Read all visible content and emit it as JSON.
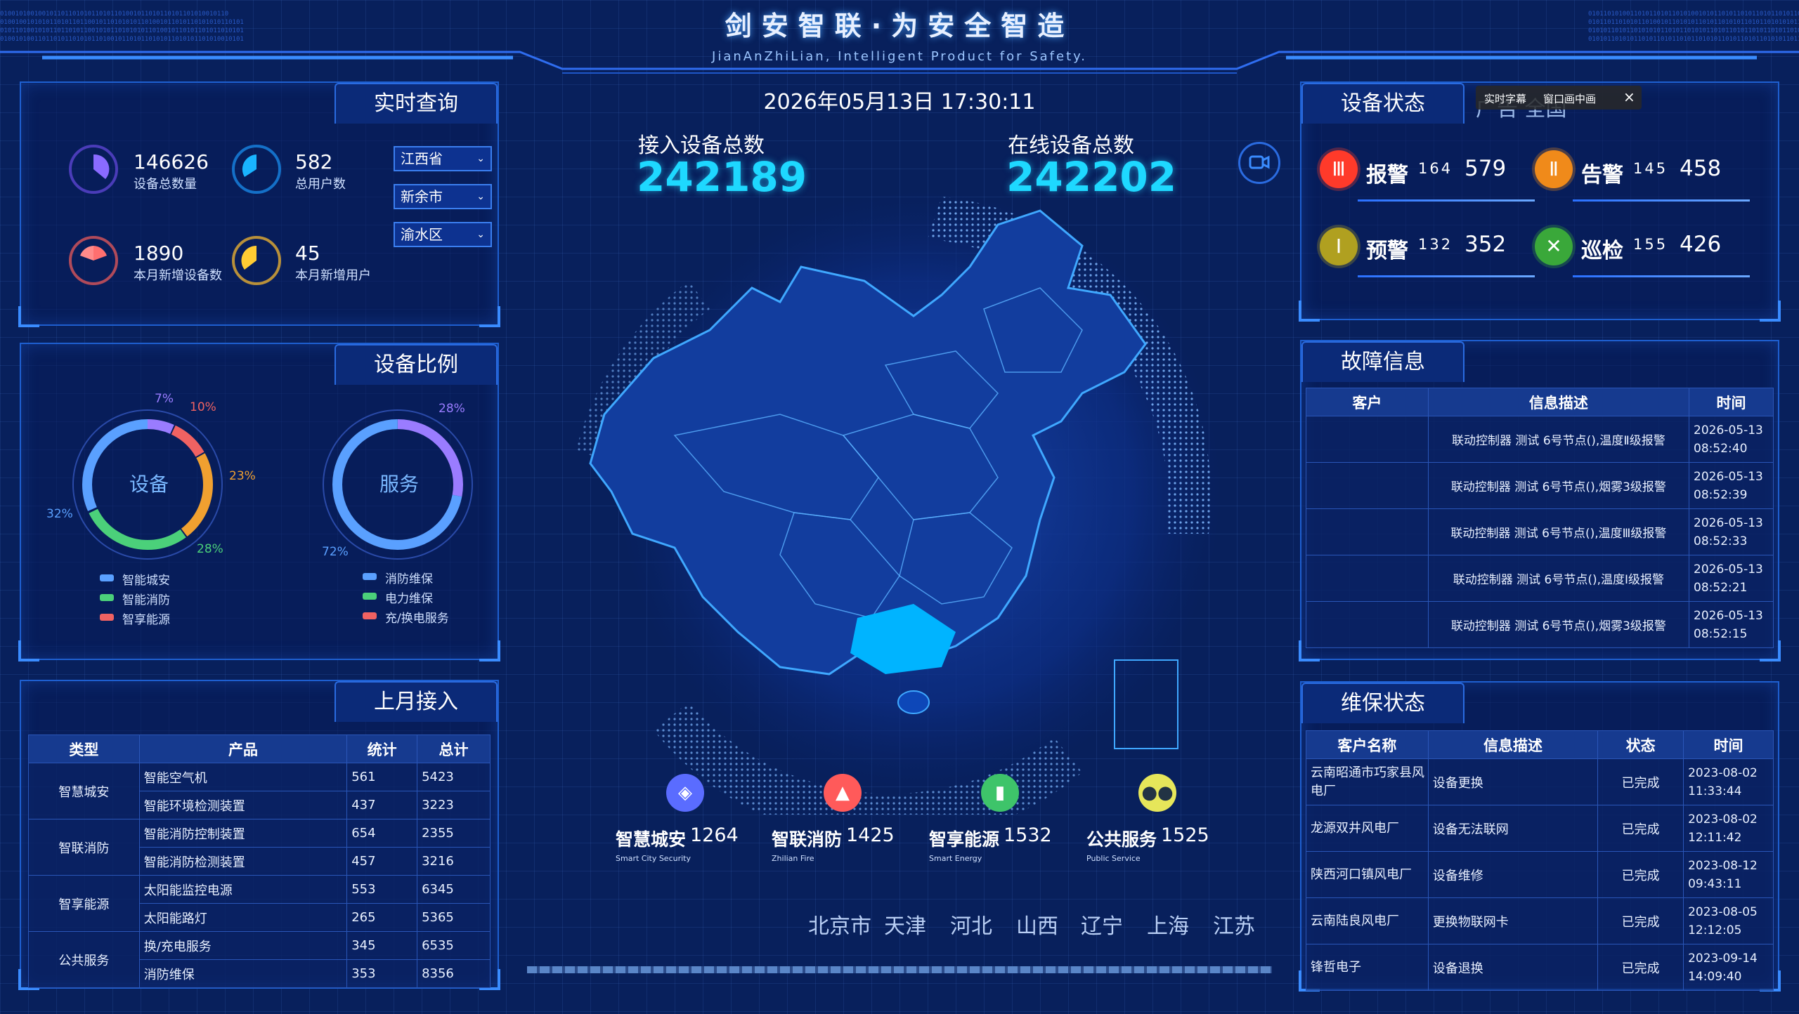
{
  "header": {
    "title": "剑安智联·为安全智造",
    "subtitle": "JianAnZhiLian, Intelligent Product for Safety.",
    "datetime": "2026年05月13日 17:30:11"
  },
  "realtime": {
    "tab": "实时查询",
    "stats": [
      {
        "value": "146626",
        "label": "设备总数量",
        "color": "#7b5cff"
      },
      {
        "value": "582",
        "label": "总用户数",
        "color": "#1ab0ff"
      },
      {
        "value": "1890",
        "label": "本月新增设备数",
        "color": "#ff6a6a"
      },
      {
        "value": "45",
        "label": "本月新增用户",
        "color": "#ffcc33"
      }
    ],
    "selects": [
      "江西省",
      "新余市",
      "渝水区"
    ]
  },
  "ratio": {
    "tab": "设备比例",
    "device": {
      "center": "设备",
      "pct_labels": [
        "7%",
        "10%",
        "23%",
        "28%",
        "32%"
      ],
      "legend": [
        "智能城安",
        "智能消防",
        "智享能源"
      ]
    },
    "service": {
      "center": "服务",
      "pct_labels": [
        "28%",
        "72%"
      ],
      "legend": [
        "消防维保",
        "电力维保",
        "充/换电服务"
      ]
    },
    "colors": {
      "blue": "#5aa0ff",
      "green": "#4bd07a",
      "red": "#f06262",
      "orange": "#f0a030",
      "purple": "#9a7cff"
    }
  },
  "last_month": {
    "tab": "上月接入",
    "headers": [
      "类型",
      "产品",
      "统计",
      "总计"
    ],
    "groups": [
      {
        "type": "智慧城安",
        "rows": [
          [
            "智能空气机",
            "561",
            "5423"
          ],
          [
            "智能环境检测装置",
            "437",
            "3223"
          ]
        ]
      },
      {
        "type": "智联消防",
        "rows": [
          [
            "智能消防控制装置",
            "654",
            "2355"
          ],
          [
            "智能消防检测装置",
            "457",
            "3216"
          ]
        ]
      },
      {
        "type": "智享能源",
        "rows": [
          [
            "太阳能监控电源",
            "553",
            "6345"
          ],
          [
            "太阳能路灯",
            "265",
            "5365"
          ]
        ]
      },
      {
        "type": "公共服务",
        "rows": [
          [
            "换/充电服务",
            "345",
            "6535"
          ],
          [
            "消防维保",
            "353",
            "8356"
          ]
        ]
      }
    ]
  },
  "center": {
    "access_label": "接入设备总数",
    "access_value": "242189",
    "online_label": "在线设备总数",
    "online_value": "242202",
    "categories": [
      {
        "name": "智慧城安",
        "value": "1264",
        "en": "Smart City Security",
        "icon": "shield-icon",
        "color": "#5a6cff"
      },
      {
        "name": "智联消防",
        "value": "1425",
        "en": "Zhilian Fire",
        "icon": "fire-extinguisher-icon",
        "color": "#ff5a5a"
      },
      {
        "name": "智享能源",
        "value": "1532",
        "en": "Smart Energy",
        "icon": "battery-icon",
        "color": "#3ec46a"
      },
      {
        "name": "公共服务",
        "value": "1525",
        "en": "Public Service",
        "icon": "people-icon",
        "color": "#e6e65a"
      }
    ],
    "provinces": [
      "北京市",
      "天津",
      "河北",
      "山西",
      "辽宁",
      "上海",
      "江苏"
    ]
  },
  "device_status": {
    "tab": "设备状态",
    "overlay_bg": "广告  全国",
    "overlay_items": [
      "实时字幕",
      "窗口画中画"
    ],
    "overlay_close": "×",
    "items": [
      {
        "badge": "Ⅲ",
        "name": "报警",
        "small": "164",
        "big": "579",
        "color": "#ff3a2a"
      },
      {
        "badge": "Ⅱ",
        "name": "告警",
        "small": "145",
        "big": "458",
        "color": "#f08a1a"
      },
      {
        "badge": "Ⅰ",
        "name": "预警",
        "small": "132",
        "big": "352",
        "color": "#b0a020"
      },
      {
        "badge": "✕",
        "name": "巡检",
        "small": "155",
        "big": "426",
        "color": "#3aa83a"
      }
    ]
  },
  "fault": {
    "tab": "故障信息",
    "headers": [
      "客户",
      "信息描述",
      "时间"
    ],
    "rows": [
      [
        "",
        "联动控制器 测试 6号节点(),温度Ⅱ级报警",
        "2026-05-13",
        "08:52:40"
      ],
      [
        "",
        "联动控制器 测试 6号节点(),烟雾3级报警",
        "2026-05-13",
        "08:52:39"
      ],
      [
        "",
        "联动控制器 测试 6号节点(),温度Ⅲ级报警",
        "2026-05-13",
        "08:52:33"
      ],
      [
        "",
        "联动控制器 测试 6号节点(),温度Ⅰ级报警",
        "2026-05-13",
        "08:52:21"
      ],
      [
        "",
        "联动控制器 测试 6号节点(),烟雾3级报警",
        "2026-05-13",
        "08:52:15"
      ]
    ]
  },
  "maintenance": {
    "tab": "维保状态",
    "headers": [
      "客户名称",
      "信息描述",
      "状态",
      "时间"
    ],
    "rows": [
      [
        "云南昭通市巧家县风电厂",
        "设备更换",
        "已完成",
        "2023-08-02",
        "11:33:44"
      ],
      [
        "龙源双井风电厂",
        "设备无法联网",
        "已完成",
        "2023-08-02",
        "12:11:42"
      ],
      [
        "陕西河口镇风电厂",
        "设备维修",
        "已完成",
        "2023-08-12",
        "09:43:11"
      ],
      [
        "云南陆良风电厂",
        "更换物联网卡",
        "已完成",
        "2023-08-05",
        "12:12:05"
      ],
      [
        "锋哲电子",
        "设备退换",
        "已完成",
        "2023-09-14",
        "14:09:40"
      ]
    ]
  }
}
